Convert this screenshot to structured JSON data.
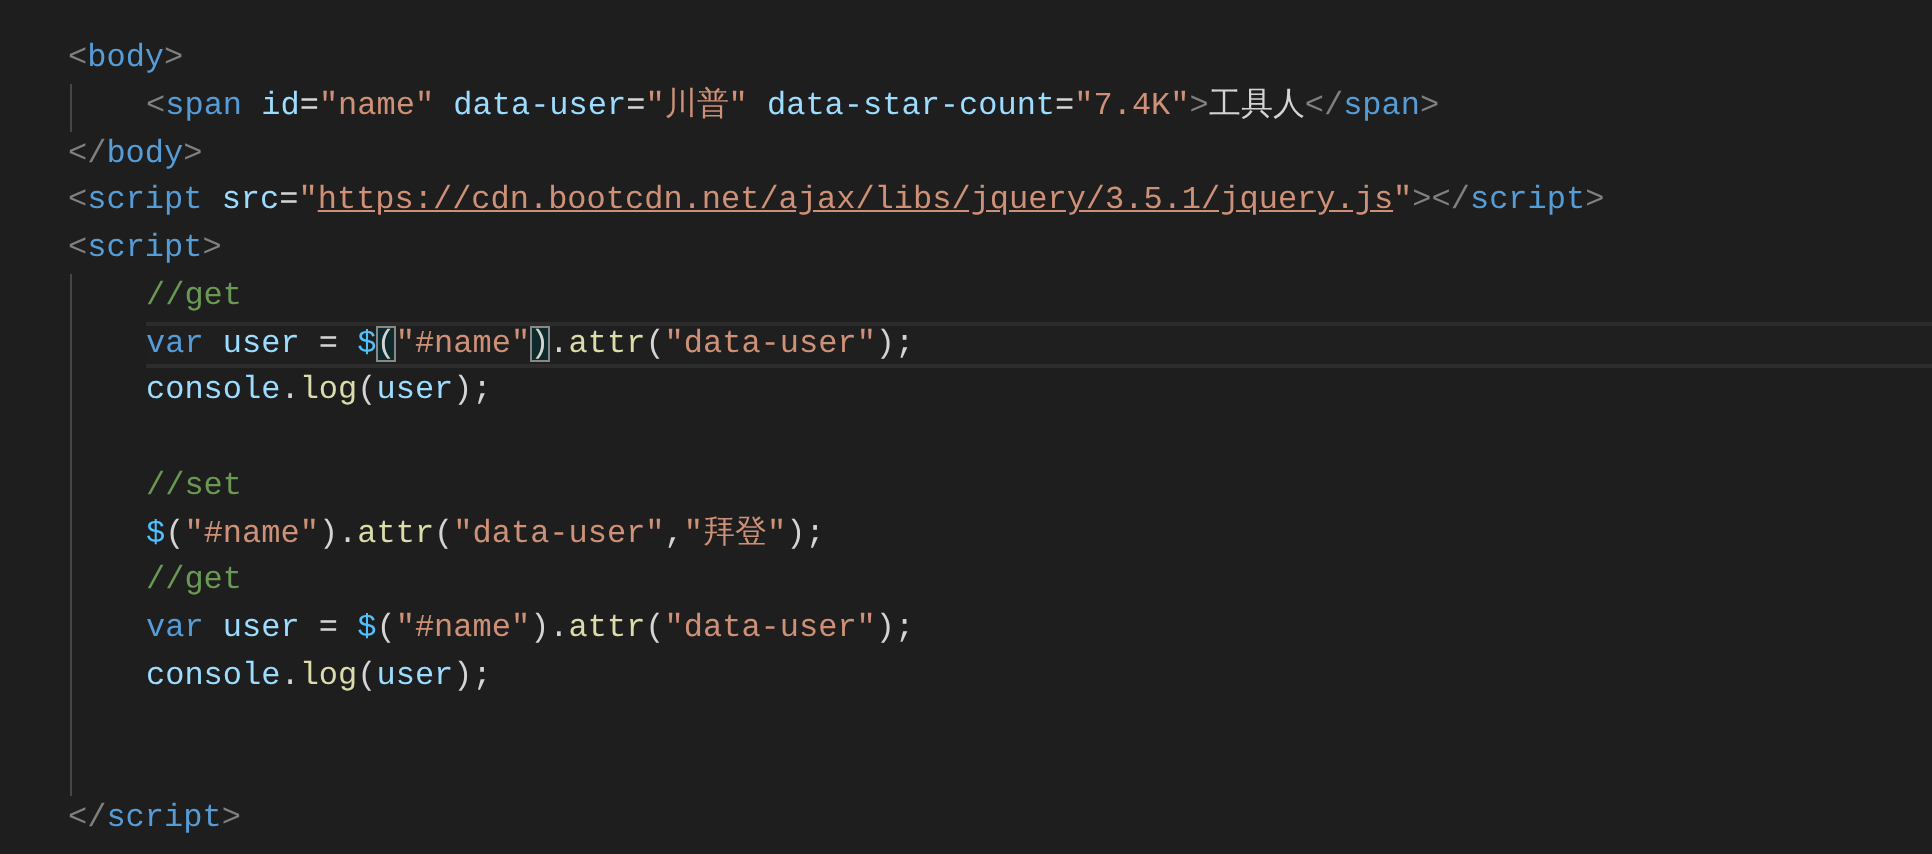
{
  "editor": {
    "lines": [
      {
        "kind": "code",
        "current": false,
        "tokens": [
          {
            "kind": "tag-punct",
            "text": "<"
          },
          {
            "kind": "tag",
            "text": "body"
          },
          {
            "kind": "tag-punct",
            "text": ">"
          }
        ],
        "children": [
          {
            "kind": "code",
            "current": false,
            "tokens": [
              {
                "kind": "tag-punct",
                "text": "<"
              },
              {
                "kind": "tag",
                "text": "span "
              },
              {
                "kind": "attr",
                "text": "id"
              },
              {
                "kind": "text",
                "text": "="
              },
              {
                "kind": "string",
                "text": "\"name\" "
              },
              {
                "kind": "attr",
                "text": "data-user"
              },
              {
                "kind": "text",
                "text": "="
              },
              {
                "kind": "string",
                "text": "\"川普\" "
              },
              {
                "kind": "attr",
                "text": "data-star-count"
              },
              {
                "kind": "text",
                "text": "="
              },
              {
                "kind": "string",
                "text": "\"7.4K\""
              },
              {
                "kind": "tag-punct",
                "text": ">"
              },
              {
                "kind": "text",
                "text": "工具人"
              },
              {
                "kind": "tag-punct",
                "text": "</"
              },
              {
                "kind": "tag",
                "text": "span"
              },
              {
                "kind": "tag-punct",
                "text": ">"
              }
            ]
          }
        ]
      },
      {
        "kind": "code",
        "current": false,
        "tokens": [
          {
            "kind": "tag-punct",
            "text": "</"
          },
          {
            "kind": "tag",
            "text": "body"
          },
          {
            "kind": "tag-punct",
            "text": ">"
          }
        ]
      },
      {
        "kind": "code",
        "current": false,
        "tokens": [
          {
            "kind": "tag-punct",
            "text": "<"
          },
          {
            "kind": "tag",
            "text": "script "
          },
          {
            "kind": "attr",
            "text": "src"
          },
          {
            "kind": "text",
            "text": "="
          },
          {
            "kind": "string",
            "text": "\""
          },
          {
            "kind": "url",
            "text": "https://cdn.bootcdn.net/ajax/libs/jquery/3.5.1/jquery.js"
          },
          {
            "kind": "string",
            "text": "\""
          },
          {
            "kind": "tag-punct",
            "text": "></"
          },
          {
            "kind": "tag",
            "text": "script"
          },
          {
            "kind": "tag-punct",
            "text": ">"
          }
        ]
      },
      {
        "kind": "code",
        "current": false,
        "tokens": [
          {
            "kind": "tag-punct",
            "text": "<"
          },
          {
            "kind": "tag",
            "text": "script"
          },
          {
            "kind": "tag-punct",
            "text": ">"
          }
        ],
        "children": [
          {
            "kind": "code",
            "current": false,
            "tokens": [
              {
                "kind": "comment",
                "text": "//get"
              }
            ]
          },
          {
            "kind": "code",
            "current": true,
            "tokens": [
              {
                "kind": "keyword",
                "text": "var "
              },
              {
                "kind": "variable",
                "text": "user"
              },
              {
                "kind": "text",
                "text": " = "
              },
              {
                "kind": "jquery",
                "text": "$"
              },
              {
                "kind": "matched-bracket",
                "text": "("
              },
              {
                "kind": "string",
                "text": "\"#name\""
              },
              {
                "kind": "matched-bracket",
                "text": ")"
              },
              {
                "kind": "text",
                "text": "."
              },
              {
                "kind": "function",
                "text": "attr"
              },
              {
                "kind": "text",
                "text": "("
              },
              {
                "kind": "string",
                "text": "\"data-user\""
              },
              {
                "kind": "text",
                "text": ");"
              }
            ]
          },
          {
            "kind": "code",
            "current": false,
            "tokens": [
              {
                "kind": "variable",
                "text": "console"
              },
              {
                "kind": "text",
                "text": "."
              },
              {
                "kind": "function",
                "text": "log"
              },
              {
                "kind": "text",
                "text": "("
              },
              {
                "kind": "variable",
                "text": "user"
              },
              {
                "kind": "text",
                "text": ");"
              }
            ]
          },
          {
            "kind": "blank"
          },
          {
            "kind": "code",
            "current": false,
            "tokens": [
              {
                "kind": "comment",
                "text": "//set"
              }
            ]
          },
          {
            "kind": "code",
            "current": false,
            "tokens": [
              {
                "kind": "jquery",
                "text": "$"
              },
              {
                "kind": "text",
                "text": "("
              },
              {
                "kind": "string",
                "text": "\"#name\""
              },
              {
                "kind": "text",
                "text": ")."
              },
              {
                "kind": "function",
                "text": "attr"
              },
              {
                "kind": "text",
                "text": "("
              },
              {
                "kind": "string",
                "text": "\"data-user\""
              },
              {
                "kind": "text",
                "text": ","
              },
              {
                "kind": "string",
                "text": "\"拜登\""
              },
              {
                "kind": "text",
                "text": ");"
              }
            ]
          },
          {
            "kind": "code",
            "current": false,
            "tokens": [
              {
                "kind": "comment",
                "text": "//get"
              }
            ]
          },
          {
            "kind": "code",
            "current": false,
            "tokens": [
              {
                "kind": "keyword",
                "text": "var "
              },
              {
                "kind": "variable",
                "text": "user"
              },
              {
                "kind": "text",
                "text": " = "
              },
              {
                "kind": "jquery",
                "text": "$"
              },
              {
                "kind": "text",
                "text": "("
              },
              {
                "kind": "string",
                "text": "\"#name\""
              },
              {
                "kind": "text",
                "text": ")."
              },
              {
                "kind": "function",
                "text": "attr"
              },
              {
                "kind": "text",
                "text": "("
              },
              {
                "kind": "string",
                "text": "\"data-user\""
              },
              {
                "kind": "text",
                "text": ");"
              }
            ]
          },
          {
            "kind": "code",
            "current": false,
            "tokens": [
              {
                "kind": "variable",
                "text": "console"
              },
              {
                "kind": "text",
                "text": "."
              },
              {
                "kind": "function",
                "text": "log"
              },
              {
                "kind": "text",
                "text": "("
              },
              {
                "kind": "variable",
                "text": "user"
              },
              {
                "kind": "text",
                "text": ");"
              }
            ]
          },
          {
            "kind": "blank"
          },
          {
            "kind": "blank"
          }
        ]
      },
      {
        "kind": "code",
        "current": false,
        "tokens": [
          {
            "kind": "tag-punct",
            "text": "</"
          },
          {
            "kind": "tag",
            "text": "script"
          },
          {
            "kind": "tag-punct",
            "text": ">"
          }
        ]
      }
    ]
  }
}
